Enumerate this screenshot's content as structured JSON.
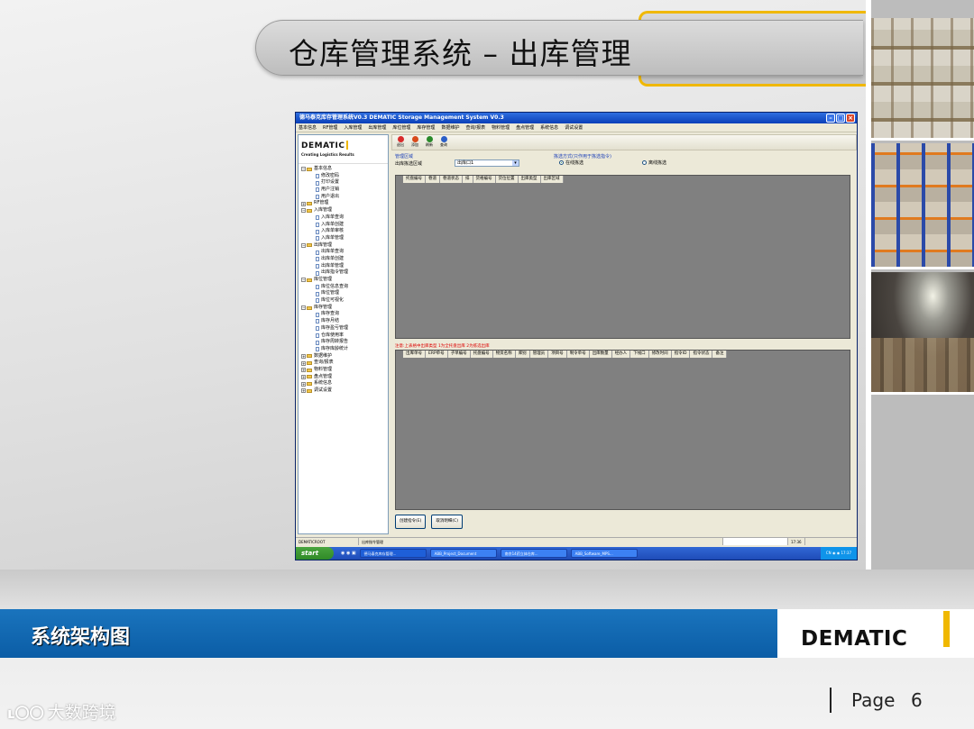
{
  "slide": {
    "title": "仓库管理系统 – 出库管理",
    "footer_title": "系统架构图",
    "footer_logo": "DEMATIC",
    "page_label": "Page",
    "page_number": "6",
    "watermark_text": "大数跨境",
    "watermark_icon": "ʟ〇〇"
  },
  "window": {
    "title": "德马泰克库存管理系统V0.3 DEMATIC Storage Management System V0.3",
    "menu": [
      "基本信息",
      "RF管理",
      "入库管理",
      "出库管理",
      "库位管理",
      "库存管理",
      "数据维护",
      "查询/报表",
      "物料管理",
      "盘点管理",
      "系统信息",
      "调试设置"
    ],
    "logo_main": "DEMATIC",
    "logo_sub": "Creating Logistics Results"
  },
  "tree": [
    {
      "label": "基本信息",
      "level": 0,
      "expander": "⊟"
    },
    {
      "label": "修改密码",
      "level": 1
    },
    {
      "label": "打印设置",
      "level": 1
    },
    {
      "label": "用户注销",
      "level": 1
    },
    {
      "label": "用户退出",
      "level": 1
    },
    {
      "label": "RF管理",
      "level": 0,
      "expander": "⊞"
    },
    {
      "label": "入库管理",
      "level": 0,
      "expander": "⊟"
    },
    {
      "label": "入库单查询",
      "level": 1
    },
    {
      "label": "入库单创建",
      "level": 1
    },
    {
      "label": "入库单审核",
      "level": 1
    },
    {
      "label": "入库单管理",
      "level": 1
    },
    {
      "label": "出库管理",
      "level": 0,
      "expander": "⊟"
    },
    {
      "label": "出库单查询",
      "level": 1
    },
    {
      "label": "出库单创建",
      "level": 1
    },
    {
      "label": "出库单管理",
      "level": 1
    },
    {
      "label": "出库指令管理",
      "level": 1
    },
    {
      "label": "库位管理",
      "level": 0,
      "expander": "⊟"
    },
    {
      "label": "库位信息查询",
      "level": 1
    },
    {
      "label": "库位管理",
      "level": 1
    },
    {
      "label": "库位可视化",
      "level": 1
    },
    {
      "label": "库存管理",
      "level": 0,
      "expander": "⊟"
    },
    {
      "label": "库存查询",
      "level": 1
    },
    {
      "label": "库存月结",
      "level": 1
    },
    {
      "label": "库存盈亏管理",
      "level": 1
    },
    {
      "label": "仓库使用率",
      "level": 1
    },
    {
      "label": "库存周转报告",
      "level": 1
    },
    {
      "label": "库存库龄统计",
      "level": 1
    },
    {
      "label": "数据维护",
      "level": 0,
      "expander": "⊞"
    },
    {
      "label": "查询/报表",
      "level": 0,
      "expander": "⊞"
    },
    {
      "label": "物料管理",
      "level": 0,
      "expander": "⊞"
    },
    {
      "label": "盘点管理",
      "level": 0,
      "expander": "⊞"
    },
    {
      "label": "系统信息",
      "level": 0,
      "expander": "⊞"
    },
    {
      "label": "调试设置",
      "level": 0,
      "expander": "⊞"
    }
  ],
  "toolbar": [
    {
      "label": "退出",
      "color": "#d92b2b"
    },
    {
      "label": "添加",
      "color": "#d84a1b"
    },
    {
      "label": "刷新",
      "color": "#2a8a2a"
    },
    {
      "label": "查询",
      "color": "#2b5fc8"
    }
  ],
  "filter": {
    "group_label": "管理区域",
    "field_label": "出库拣选区域",
    "combo_value": "出库口1",
    "combo_arrow": "▾",
    "mode_label": "拣选方式(只作用于拣选指令)",
    "radio_online": "在线拣选",
    "radio_offline": "离线拣选"
  },
  "grid1": {
    "columns": [
      "托盘编号",
      "巷道",
      "巷道状态",
      "排",
      "货格编号",
      "货位位置",
      "出库类型",
      "出库区域"
    ]
  },
  "note": "注意:上表格中出库类型 1为全托盘出库  2为拣选出库",
  "grid2": {
    "columns": [
      "出库单号",
      "ERP单号",
      "子单编号",
      "托盘编号",
      "物资名称",
      "库别",
      "管理员",
      "项目号",
      "制令单号",
      "出库数量",
      "经办人",
      "下线口",
      "修改时间",
      "指令ID",
      "指令状态",
      "备注"
    ]
  },
  "buttons": {
    "create": "创建指令(E)",
    "cancel": "取消明细(C)"
  },
  "statusbar": {
    "user": "DEMATICROOT",
    "screen": "出库指令管理",
    "time": "17:36"
  },
  "taskbar": {
    "start": "start",
    "quicklaunch": "◉ ◉ ▣",
    "tasks": [
      "德马泰克库存管理...",
      "ABB_Project_Document",
      "南京14药立体仓库...",
      "ABB_Software_MPS..."
    ],
    "tray": "CN  ◉ ◉  17:37"
  }
}
